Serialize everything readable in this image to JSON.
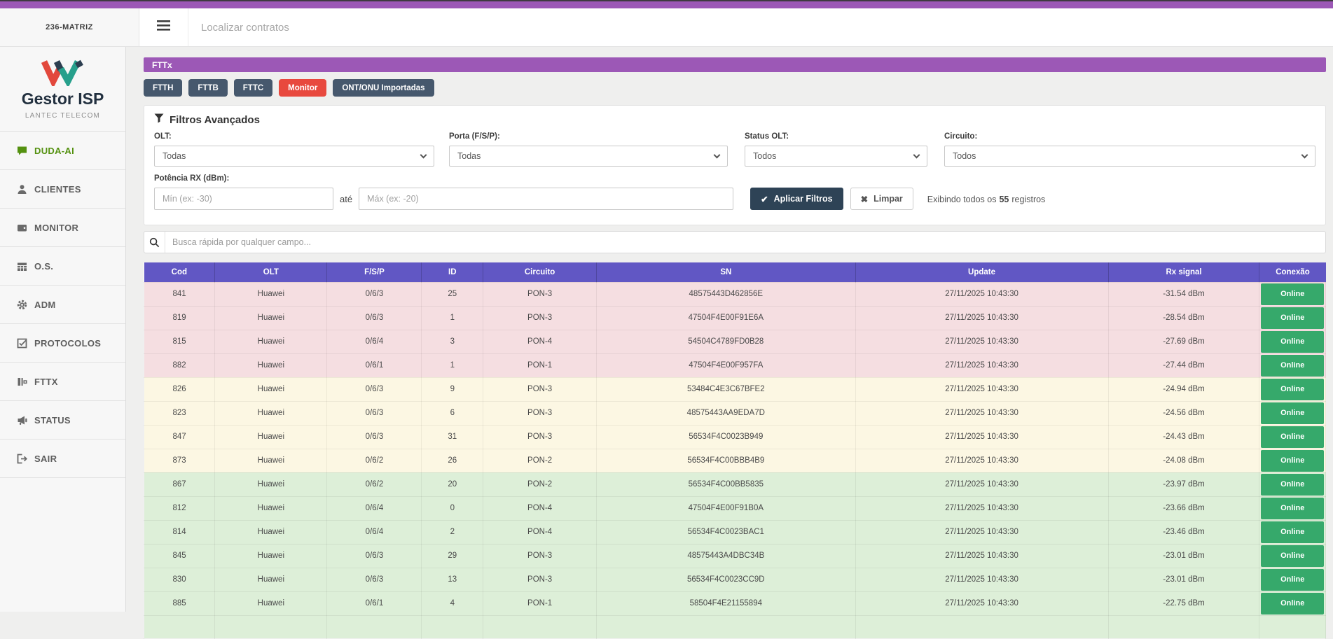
{
  "topbar": {
    "workspace_label": "236-MATRIZ",
    "search_placeholder": "Localizar contratos"
  },
  "sidebar": {
    "logo": {
      "title": "Gestor ISP",
      "subtitle": "LANTEC TELECOM"
    },
    "items": [
      {
        "label": "DUDA-AI",
        "icon": "chat-icon",
        "active": true
      },
      {
        "label": "CLIENTES",
        "icon": "clients-icon",
        "active": false
      },
      {
        "label": "MONITOR",
        "icon": "monitor-icon",
        "active": false
      },
      {
        "label": "O.S.",
        "icon": "calendar-icon",
        "active": false
      },
      {
        "label": "ADM",
        "icon": "gear-icon",
        "active": false
      },
      {
        "label": "PROTOCOLOS",
        "icon": "protocols-icon",
        "active": false
      },
      {
        "label": "FTTX",
        "icon": "fttx-icon",
        "active": false
      },
      {
        "label": "STATUS",
        "icon": "status-icon",
        "active": false
      },
      {
        "label": "SAIR",
        "icon": "logout-icon",
        "active": false
      }
    ]
  },
  "page": {
    "title": "FTTx",
    "tabs": [
      {
        "label": "FTTH",
        "variant": "dark"
      },
      {
        "label": "FTTB",
        "variant": "dark"
      },
      {
        "label": "FTTC",
        "variant": "dark"
      },
      {
        "label": "Monitor",
        "variant": "red"
      },
      {
        "label": "ONT/ONU Importadas",
        "variant": "dark"
      }
    ]
  },
  "filters": {
    "title": "Filtros Avançados",
    "fields": [
      {
        "label": "OLT:",
        "value": "Todas"
      },
      {
        "label": "Porta (F/S/P):",
        "value": "Todas"
      },
      {
        "label": "Status OLT:",
        "value": "Todos"
      },
      {
        "label": "Circuito:",
        "value": "Todos"
      }
    ],
    "potencia": {
      "label": "Potência RX (dBm):",
      "min_placeholder": "Mín (ex: -30)",
      "separator": "até",
      "max_placeholder": "Máx (ex: -20)"
    },
    "apply_label": "Aplicar Filtros",
    "clear_label": "Limpar",
    "records": {
      "prefix": "Exibindo todos os",
      "count": "55",
      "suffix": "registros"
    }
  },
  "quick_search": {
    "placeholder": "Busca rápida por qualquer campo..."
  },
  "table": {
    "columns": [
      "Cod",
      "OLT",
      "F/S/P",
      "ID",
      "Circuito",
      "SN",
      "Update",
      "Rx signal",
      "Conexão"
    ],
    "rows": [
      {
        "cod": "841",
        "olt": "Huawei",
        "fsp": "0/6/3",
        "id": "25",
        "circuito": "PON-3",
        "sn": "48575443D462856E",
        "update": "27/11/2025 10:43:30",
        "rx": "-31.54 dBm",
        "conexao": "Online",
        "severity": "danger"
      },
      {
        "cod": "819",
        "olt": "Huawei",
        "fsp": "0/6/3",
        "id": "1",
        "circuito": "PON-3",
        "sn": "47504F4E00F91E6A",
        "update": "27/11/2025 10:43:30",
        "rx": "-28.54 dBm",
        "conexao": "Online",
        "severity": "danger"
      },
      {
        "cod": "815",
        "olt": "Huawei",
        "fsp": "0/6/4",
        "id": "3",
        "circuito": "PON-4",
        "sn": "54504C4789FD0B28",
        "update": "27/11/2025 10:43:30",
        "rx": "-27.69 dBm",
        "conexao": "Online",
        "severity": "danger"
      },
      {
        "cod": "882",
        "olt": "Huawei",
        "fsp": "0/6/1",
        "id": "1",
        "circuito": "PON-1",
        "sn": "47504F4E00F957FA",
        "update": "27/11/2025 10:43:30",
        "rx": "-27.44 dBm",
        "conexao": "Online",
        "severity": "danger"
      },
      {
        "cod": "826",
        "olt": "Huawei",
        "fsp": "0/6/3",
        "id": "9",
        "circuito": "PON-3",
        "sn": "53484C4E3C67BFE2",
        "update": "27/11/2025 10:43:30",
        "rx": "-24.94 dBm",
        "conexao": "Online",
        "severity": "warning"
      },
      {
        "cod": "823",
        "olt": "Huawei",
        "fsp": "0/6/3",
        "id": "6",
        "circuito": "PON-3",
        "sn": "48575443AA9EDA7D",
        "update": "27/11/2025 10:43:30",
        "rx": "-24.56 dBm",
        "conexao": "Online",
        "severity": "warning"
      },
      {
        "cod": "847",
        "olt": "Huawei",
        "fsp": "0/6/3",
        "id": "31",
        "circuito": "PON-3",
        "sn": "56534F4C0023B949",
        "update": "27/11/2025 10:43:30",
        "rx": "-24.43 dBm",
        "conexao": "Online",
        "severity": "warning"
      },
      {
        "cod": "873",
        "olt": "Huawei",
        "fsp": "0/6/2",
        "id": "26",
        "circuito": "PON-2",
        "sn": "56534F4C00BBB4B9",
        "update": "27/11/2025 10:43:30",
        "rx": "-24.08 dBm",
        "conexao": "Online",
        "severity": "warning"
      },
      {
        "cod": "867",
        "olt": "Huawei",
        "fsp": "0/6/2",
        "id": "20",
        "circuito": "PON-2",
        "sn": "56534F4C00BB5835",
        "update": "27/11/2025 10:43:30",
        "rx": "-23.97 dBm",
        "conexao": "Online",
        "severity": "success"
      },
      {
        "cod": "812",
        "olt": "Huawei",
        "fsp": "0/6/4",
        "id": "0",
        "circuito": "PON-4",
        "sn": "47504F4E00F91B0A",
        "update": "27/11/2025 10:43:30",
        "rx": "-23.66 dBm",
        "conexao": "Online",
        "severity": "success"
      },
      {
        "cod": "814",
        "olt": "Huawei",
        "fsp": "0/6/4",
        "id": "2",
        "circuito": "PON-4",
        "sn": "56534F4C0023BAC1",
        "update": "27/11/2025 10:43:30",
        "rx": "-23.46 dBm",
        "conexao": "Online",
        "severity": "success"
      },
      {
        "cod": "845",
        "olt": "Huawei",
        "fsp": "0/6/3",
        "id": "29",
        "circuito": "PON-3",
        "sn": "48575443A4DBC34B",
        "update": "27/11/2025 10:43:30",
        "rx": "-23.01 dBm",
        "conexao": "Online",
        "severity": "success"
      },
      {
        "cod": "830",
        "olt": "Huawei",
        "fsp": "0/6/3",
        "id": "13",
        "circuito": "PON-3",
        "sn": "56534F4C0023CC9D",
        "update": "27/11/2025 10:43:30",
        "rx": "-23.01 dBm",
        "conexao": "Online",
        "severity": "success"
      },
      {
        "cod": "885",
        "olt": "Huawei",
        "fsp": "0/6/1",
        "id": "4",
        "circuito": "PON-1",
        "sn": "58504F4E21155894",
        "update": "27/11/2025 10:43:30",
        "rx": "-22.75 dBm",
        "conexao": "Online",
        "severity": "success"
      },
      {
        "cod": "",
        "olt": "",
        "fsp": "",
        "id": "",
        "circuito": "",
        "sn": "",
        "update": "",
        "rx": "",
        "conexao": "",
        "severity": "success"
      }
    ]
  },
  "colors": {
    "purple": "#9c58b6",
    "table_header": "#6157c4",
    "tab_dark": "#46586d",
    "tab_red": "#e8493e",
    "apply_btn": "#2e4356",
    "online_green": "#36a96b",
    "row_danger": "#f5dee1",
    "row_warning": "#fcf7e3",
    "row_success": "#ddefd8",
    "menu_active": "#549110"
  }
}
